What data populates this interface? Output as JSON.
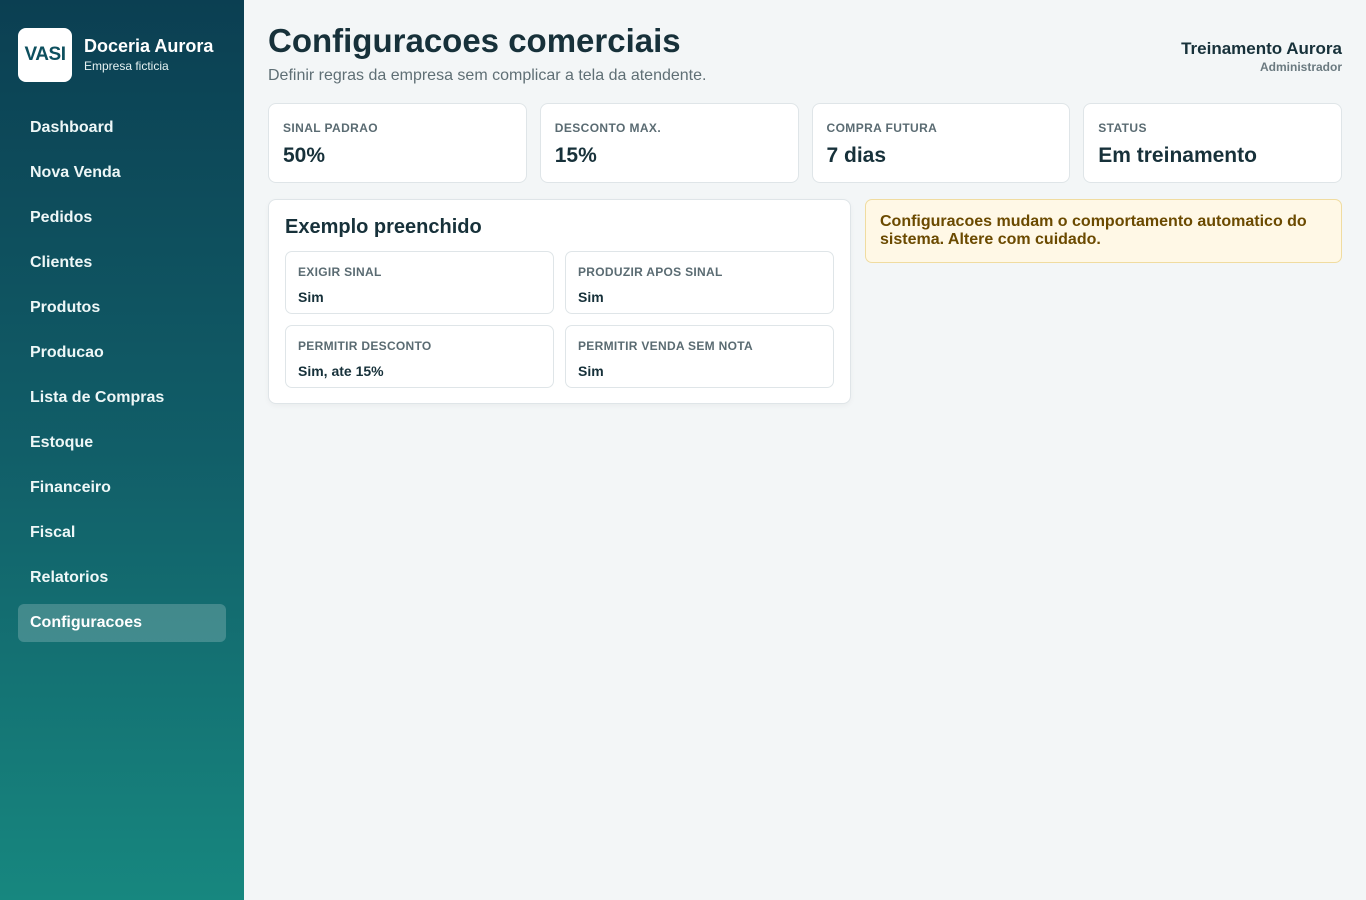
{
  "brand": {
    "logo_text": "VASI",
    "name": "Doceria Aurora",
    "subtitle": "Empresa ficticia"
  },
  "sidebar": {
    "items": [
      {
        "label": "Dashboard",
        "active": false
      },
      {
        "label": "Nova Venda",
        "active": false
      },
      {
        "label": "Pedidos",
        "active": false
      },
      {
        "label": "Clientes",
        "active": false
      },
      {
        "label": "Produtos",
        "active": false
      },
      {
        "label": "Producao",
        "active": false
      },
      {
        "label": "Lista de Compras",
        "active": false
      },
      {
        "label": "Estoque",
        "active": false
      },
      {
        "label": "Financeiro",
        "active": false
      },
      {
        "label": "Fiscal",
        "active": false
      },
      {
        "label": "Relatorios",
        "active": false
      },
      {
        "label": "Configuracoes",
        "active": true
      }
    ]
  },
  "header": {
    "title": "Configuracoes comerciais",
    "subtitle": "Definir regras da empresa sem complicar a tela da atendente.",
    "user_name": "Treinamento Aurora",
    "user_role": "Administrador"
  },
  "stats": [
    {
      "label": "SINAL PADRAO",
      "value": "50%"
    },
    {
      "label": "DESCONTO MAX.",
      "value": "15%"
    },
    {
      "label": "COMPRA FUTURA",
      "value": "7 dias"
    },
    {
      "label": "STATUS",
      "value": "Em treinamento"
    }
  ],
  "example": {
    "title": "Exemplo preenchido",
    "fields": [
      {
        "label": "EXIGIR SINAL",
        "value": "Sim"
      },
      {
        "label": "PRODUZIR APOS SINAL",
        "value": "Sim"
      },
      {
        "label": "PERMITIR DESCONTO",
        "value": "Sim, ate 15%"
      },
      {
        "label": "PERMITIR VENDA SEM NOTA",
        "value": "Sim"
      }
    ]
  },
  "alert": {
    "text": "Configuracoes mudam o comportamento automatico do sistema. Altere com cuidado."
  },
  "colors": {
    "sidebar_top": "#0b3f52",
    "sidebar_bottom": "#17877f",
    "background": "#f3f6f7",
    "text_primary": "#17313a",
    "alert_bg": "#fff8e6",
    "alert_text": "#6b4a00"
  }
}
